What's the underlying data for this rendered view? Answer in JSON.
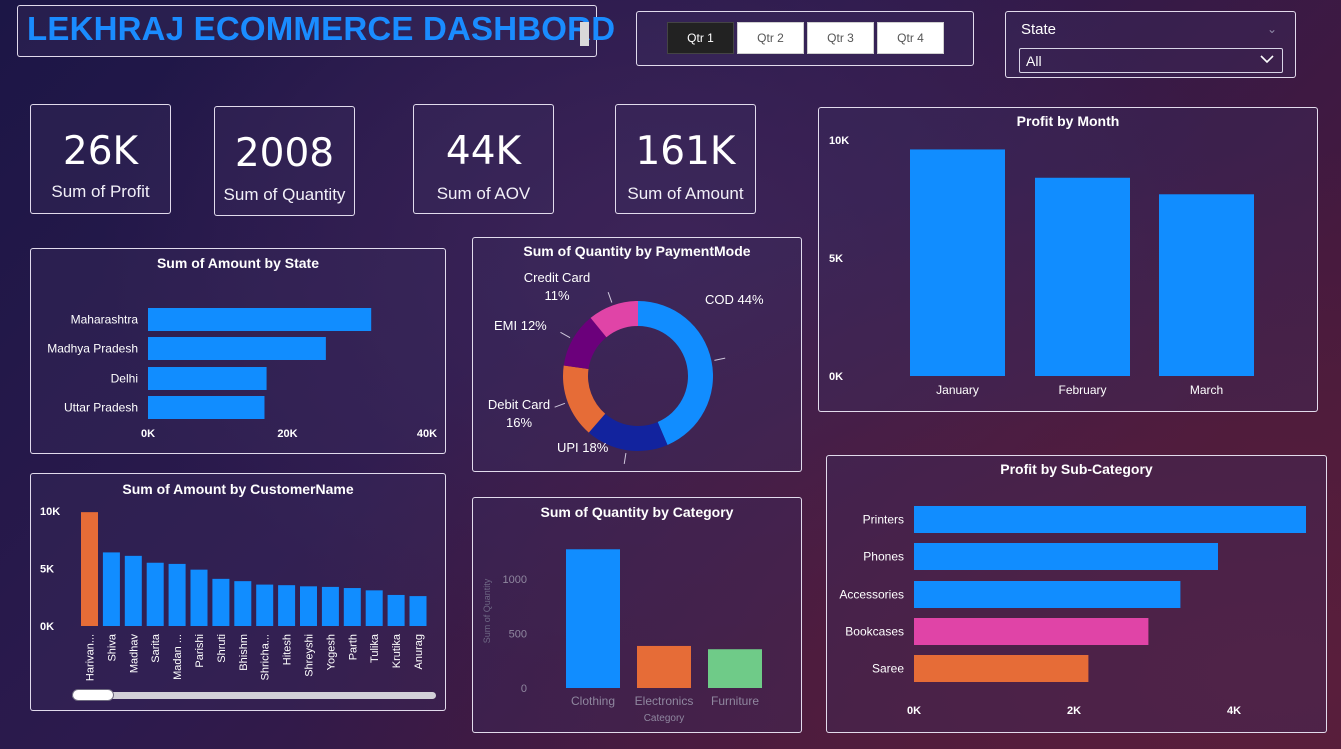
{
  "header": {
    "title": "LEKHRAJ ECOMMERCE DASHBORD"
  },
  "quarter_slicer": {
    "items": [
      "Qtr 1",
      "Qtr 2",
      "Qtr 3",
      "Qtr 4"
    ],
    "selected": "Qtr 1"
  },
  "state_slicer": {
    "label": "State",
    "value": "All"
  },
  "kpis": [
    {
      "value": "26K",
      "label": "Sum of Profit"
    },
    {
      "value": "2008",
      "label": "Sum of Quantity"
    },
    {
      "value": "44K",
      "label": "Sum of AOV"
    },
    {
      "value": "161K",
      "label": "Sum of Amount"
    }
  ],
  "colors": {
    "blue": "#118dff",
    "orange": "#e66c37",
    "navy": "#12239e",
    "purple": "#6b007b",
    "pink": "#e044a7",
    "green": "#6fcb88",
    "title_blue": "#1a8cff"
  },
  "chart_data": [
    {
      "id": "amount_by_state",
      "type": "bar",
      "orientation": "horizontal",
      "title": "Sum of Amount by State",
      "categories": [
        "Maharashtra",
        "Madhya Pradesh",
        "Delhi",
        "Uttar Pradesh"
      ],
      "values": [
        32000,
        25500,
        17000,
        16700
      ],
      "xlim": [
        0,
        40000
      ],
      "xticks": [
        "0K",
        "20K",
        "40K"
      ],
      "grid": false
    },
    {
      "id": "quantity_by_paymentmode",
      "type": "pie",
      "donut": true,
      "title": "Sum of Quantity by PaymentMode",
      "slices": [
        {
          "label": "COD",
          "pct_text": "44%",
          "value": 44,
          "color": "#118dff"
        },
        {
          "label": "UPI",
          "pct_text": "18%",
          "value": 18,
          "color": "#12239e"
        },
        {
          "label": "Debit Card",
          "pct_text": "16%",
          "value": 16,
          "color": "#e66c37"
        },
        {
          "label": "EMI",
          "pct_text": "12%",
          "value": 12,
          "color": "#6b007b"
        },
        {
          "label": "Credit Card",
          "pct_text": "11%",
          "value": 11,
          "color": "#e044a7"
        }
      ]
    },
    {
      "id": "profit_by_month",
      "type": "bar",
      "title": "Profit by Month",
      "categories": [
        "January",
        "February",
        "March"
      ],
      "values": [
        9600,
        8400,
        7700
      ],
      "ylim": [
        0,
        10000
      ],
      "yticks": [
        "0K",
        "5K",
        "10K"
      ],
      "grid": false
    },
    {
      "id": "amount_by_customer",
      "type": "bar",
      "title": "Sum of Amount by CustomerName",
      "categories": [
        "Harivan...",
        "Shiva",
        "Madhav",
        "Sarita",
        "Madan ...",
        "Parishi",
        "Shruti",
        "Bhishm",
        "Shricha...",
        "Hitesh",
        "Shreyshi",
        "Yogesh",
        "Parth",
        "Tulika",
        "Krutika",
        "Anurag"
      ],
      "values": [
        9900,
        6400,
        6100,
        5500,
        5400,
        4900,
        4100,
        3900,
        3600,
        3550,
        3450,
        3400,
        3300,
        3100,
        2700,
        2600
      ],
      "highlight_index": 0,
      "ylim": [
        0,
        10000
      ],
      "yticks": [
        "0K",
        "5K",
        "10K"
      ],
      "grid": false
    },
    {
      "id": "quantity_by_category",
      "type": "bar",
      "title": "Sum of Quantity by Category",
      "xlabel": "Category",
      "ylabel": "Sum of Quantity",
      "categories": [
        "Clothing",
        "Electronics",
        "Furniture"
      ],
      "values": [
        1270,
        385,
        355
      ],
      "colors": [
        "#118dff",
        "#e66c37",
        "#6fcb88"
      ],
      "ylim": [
        0,
        1300
      ],
      "yticks": [
        "0",
        "500",
        "1000"
      ],
      "grid": false
    },
    {
      "id": "profit_by_subcategory",
      "type": "bar",
      "orientation": "horizontal",
      "title": "Profit by Sub-Category",
      "categories": [
        "Printers",
        "Phones",
        "Accessories",
        "Bookcases",
        "Saree"
      ],
      "values": [
        4900,
        3800,
        3330,
        2930,
        2180
      ],
      "colors": [
        "#118dff",
        "#118dff",
        "#118dff",
        "#e044a7",
        "#e66c37"
      ],
      "xlim": [
        0,
        5000
      ],
      "xticks": [
        "0K",
        "2K",
        "4K"
      ],
      "grid": false
    }
  ]
}
